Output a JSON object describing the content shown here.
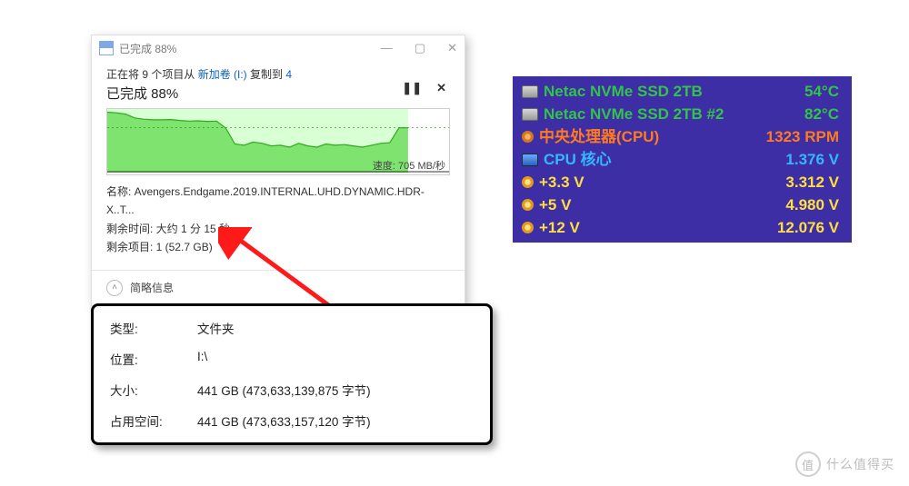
{
  "copy": {
    "window_title": "已完成 88%",
    "summary_prefix": "正在将 9 个项目从 ",
    "summary_src": "新加卷 (I:)",
    "summary_mid": " 复制到 ",
    "summary_dst": "4",
    "progress_line": "已完成 88%",
    "pause_glyph": "❚❚",
    "cancel_glyph": "✕",
    "speed_label": "速度: 705 MB/秒",
    "name_label": "名称:  Avengers.Endgame.2019.INTERNAL.UHD.DYNAMIC.HDR-X..T...",
    "time_label": "剩余时间: 大约 1 分 15 秒",
    "items_label": "剩余项目: 1 (52.7 GB)",
    "details_toggle": "简略信息"
  },
  "chart_data": {
    "type": "area",
    "title": "",
    "xlabel": "",
    "ylabel": "MB/秒",
    "ylim": [
      0,
      1000
    ],
    "x": [
      0,
      1,
      2,
      3,
      4,
      5,
      6,
      7,
      8,
      9,
      10,
      11,
      12,
      13,
      14,
      15,
      16,
      17,
      18,
      19,
      20,
      21,
      22,
      23,
      24,
      25,
      26,
      27,
      28,
      29,
      30,
      31,
      32,
      33,
      34,
      35
    ],
    "values": [
      950,
      940,
      920,
      860,
      840,
      830,
      830,
      835,
      820,
      810,
      815,
      805,
      810,
      700,
      450,
      430,
      480,
      460,
      420,
      430,
      400,
      460,
      420,
      400,
      450,
      430,
      440,
      420,
      400,
      430,
      460,
      470,
      705,
      705,
      null,
      null
    ],
    "current": 705,
    "progress_pct": 88
  },
  "props": {
    "rows": [
      {
        "k": "类型:",
        "v": "文件夹"
      },
      {
        "k": "位置:",
        "v": "I:\\"
      },
      {
        "k": "大小:",
        "v": "441 GB (473,633,139,875 字节)"
      },
      {
        "k": "占用空间:",
        "v": "441 GB (473,633,157,120 字节)"
      }
    ]
  },
  "sensors": {
    "rows": [
      {
        "ico": "disk",
        "cls": "c-green",
        "lbl": "Netac NVMe SSD 2TB",
        "val": "54°C"
      },
      {
        "ico": "disk",
        "cls": "c-green",
        "lbl": "Netac NVMe SSD 2TB #2",
        "val": "82°C"
      },
      {
        "ico": "fan",
        "cls": "c-orange",
        "lbl": "中央处理器(CPU)",
        "val": "1323 RPM"
      },
      {
        "ico": "cpu",
        "cls": "c-cyan",
        "lbl": "CPU 核心",
        "val": "1.376 V"
      },
      {
        "ico": "volt",
        "cls": "c-yellow",
        "lbl": "+3.3 V",
        "val": "3.312 V"
      },
      {
        "ico": "volt",
        "cls": "c-yellow",
        "lbl": "+5 V",
        "val": "4.980 V"
      },
      {
        "ico": "volt",
        "cls": "c-yellow",
        "lbl": "+12 V",
        "val": "12.076 V"
      }
    ]
  },
  "watermark": {
    "badge": "值",
    "text": "什么值得买"
  }
}
